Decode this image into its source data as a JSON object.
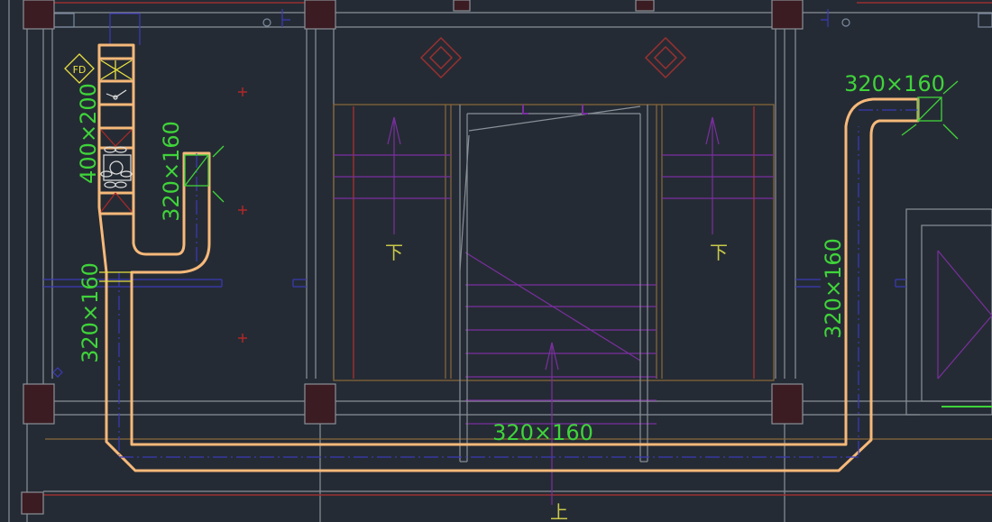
{
  "drawing": {
    "background": "#252b34",
    "duct_color": "#f6b97a",
    "dimension_color": "#3fd43a",
    "column_color": "#3a1c22",
    "stair_color": "#7a2fa0",
    "wall_color": "#8a9098"
  },
  "labels": {
    "duct_left_vertical": "400×200",
    "duct_branch_vertical": "320×160",
    "duct_left_lower": "320×160",
    "duct_right_vertical": "320×160",
    "duct_top_right": "320×160",
    "duct_bottom": "320×160",
    "stair_down_left": "下",
    "stair_down_right": "下",
    "stair_up": "上",
    "fire_damper": "FD"
  }
}
